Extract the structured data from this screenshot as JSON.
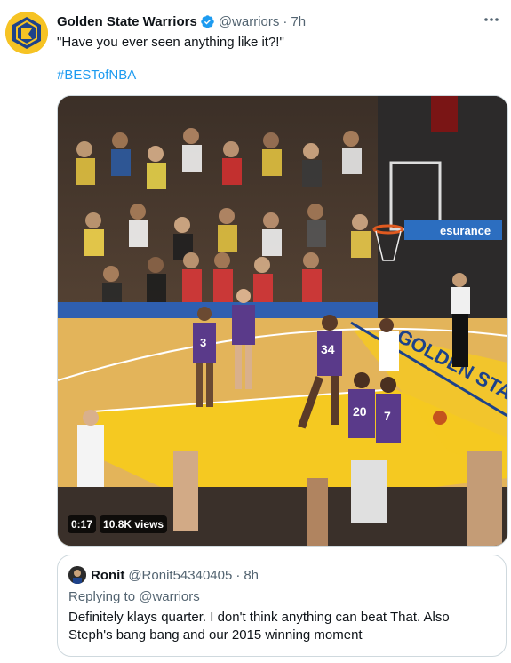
{
  "tweet": {
    "author_name": "Golden State Warriors",
    "handle": "@warriors",
    "separator": "·",
    "time": "7h",
    "text": "\"Have you ever seen anything like it?!\"",
    "hashtag": "#BESTofNBA",
    "more_icon": "more-icon",
    "verified_icon": "verified-badge-icon"
  },
  "video": {
    "duration": "0:17",
    "views": "10.8K views",
    "jersey_numbers": [
      "3",
      "34",
      "20",
      "7"
    ],
    "court_text": "GOLDEN STATE",
    "banner_text": "esurance"
  },
  "quote": {
    "author_name": "Ronit",
    "handle": "@Ronit54340405",
    "separator": "·",
    "time": "8h",
    "replying_to": "Replying to @warriors",
    "text": "Definitely klays quarter. I don't think anything can beat That. Also Steph's bang bang and our 2015 winning moment"
  },
  "colors": {
    "link": "#1d9bf0",
    "secondary_text": "#536471",
    "primary_text": "#0f1419",
    "border": "#cfd9de",
    "warriors_gold": "#f6c324"
  }
}
